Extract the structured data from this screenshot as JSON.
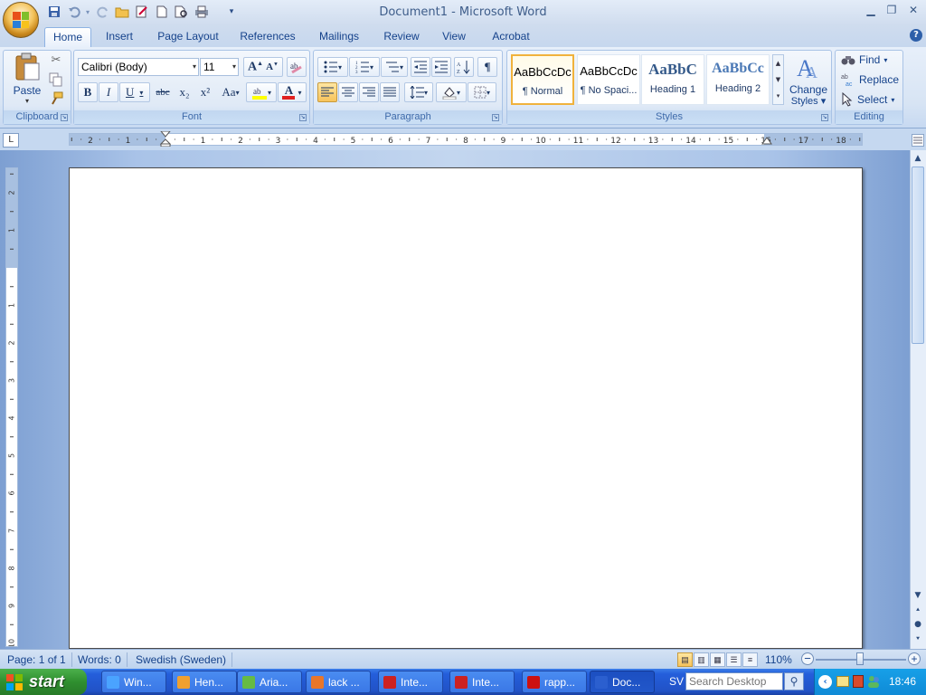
{
  "window": {
    "title": "Document1 - Microsoft Word"
  },
  "qat": {
    "customize_arrow": "▾"
  },
  "tabs": [
    {
      "label": "Home"
    },
    {
      "label": "Insert"
    },
    {
      "label": "Page Layout"
    },
    {
      "label": "References"
    },
    {
      "label": "Mailings"
    },
    {
      "label": "Review"
    },
    {
      "label": "View"
    },
    {
      "label": "Acrobat"
    }
  ],
  "ribbon": {
    "clipboard": {
      "group_label": "Clipboard",
      "paste_label": "Paste"
    },
    "font": {
      "group_label": "Font",
      "font_name": "Calibri (Body)",
      "font_size": "11",
      "bold": "B",
      "italic": "I",
      "underline": "U",
      "strike": "abc",
      "subscript": "x₂",
      "superscript": "x²",
      "change_case": "Aa",
      "font_color": "A"
    },
    "paragraph": {
      "group_label": "Paragraph",
      "pilcrow": "¶"
    },
    "styles": {
      "group_label": "Styles",
      "items": [
        {
          "sample": "AaBbCcDc",
          "name": "¶ Normal"
        },
        {
          "sample": "AaBbCcDc",
          "name": "¶ No Spaci..."
        },
        {
          "sample": "AaBbC",
          "name": "Heading 1"
        },
        {
          "sample": "AaBbCc",
          "name": "Heading 2"
        }
      ],
      "change_styles_line1": "Change",
      "change_styles_line2": "Styles"
    },
    "editing": {
      "group_label": "Editing",
      "find": "Find",
      "replace": "Replace",
      "select": "Select"
    }
  },
  "ruler": {
    "left_numbers": [
      "2",
      "1"
    ],
    "right_numbers": [
      "1",
      "2",
      "3",
      "4",
      "5",
      "6",
      "7",
      "8",
      "9",
      "10",
      "11",
      "12",
      "13",
      "14",
      "15",
      "16",
      "17",
      "18"
    ],
    "tab_selector": "L"
  },
  "vertical_ruler": {
    "numbers": [
      "2",
      "1",
      "1",
      "2",
      "3",
      "4",
      "5",
      "6",
      "7",
      "8",
      "9",
      "10"
    ]
  },
  "statusbar": {
    "page": "Page: 1 of 1",
    "words": "Words: 0",
    "language": "Swedish (Sweden)",
    "zoom": "110%"
  },
  "taskbar": {
    "start_label": "start",
    "tasks": [
      {
        "label": "Win...",
        "color": "#4aa3ff"
      },
      {
        "label": "Hen...",
        "color": "#f0a030"
      },
      {
        "label": "Aria...",
        "color": "#66bb44"
      },
      {
        "label": "lack ...",
        "color": "#e8762a"
      },
      {
        "label": "Inte...",
        "color": "#cc2222"
      },
      {
        "label": "Inte...",
        "color": "#cc2222"
      },
      {
        "label": "rapp...",
        "color": "#cc1111"
      },
      {
        "label": "Doc...",
        "color": "#2b5fcf"
      }
    ],
    "lang": "SV",
    "search_placeholder": "Search Desktop",
    "clock": "18:46"
  }
}
